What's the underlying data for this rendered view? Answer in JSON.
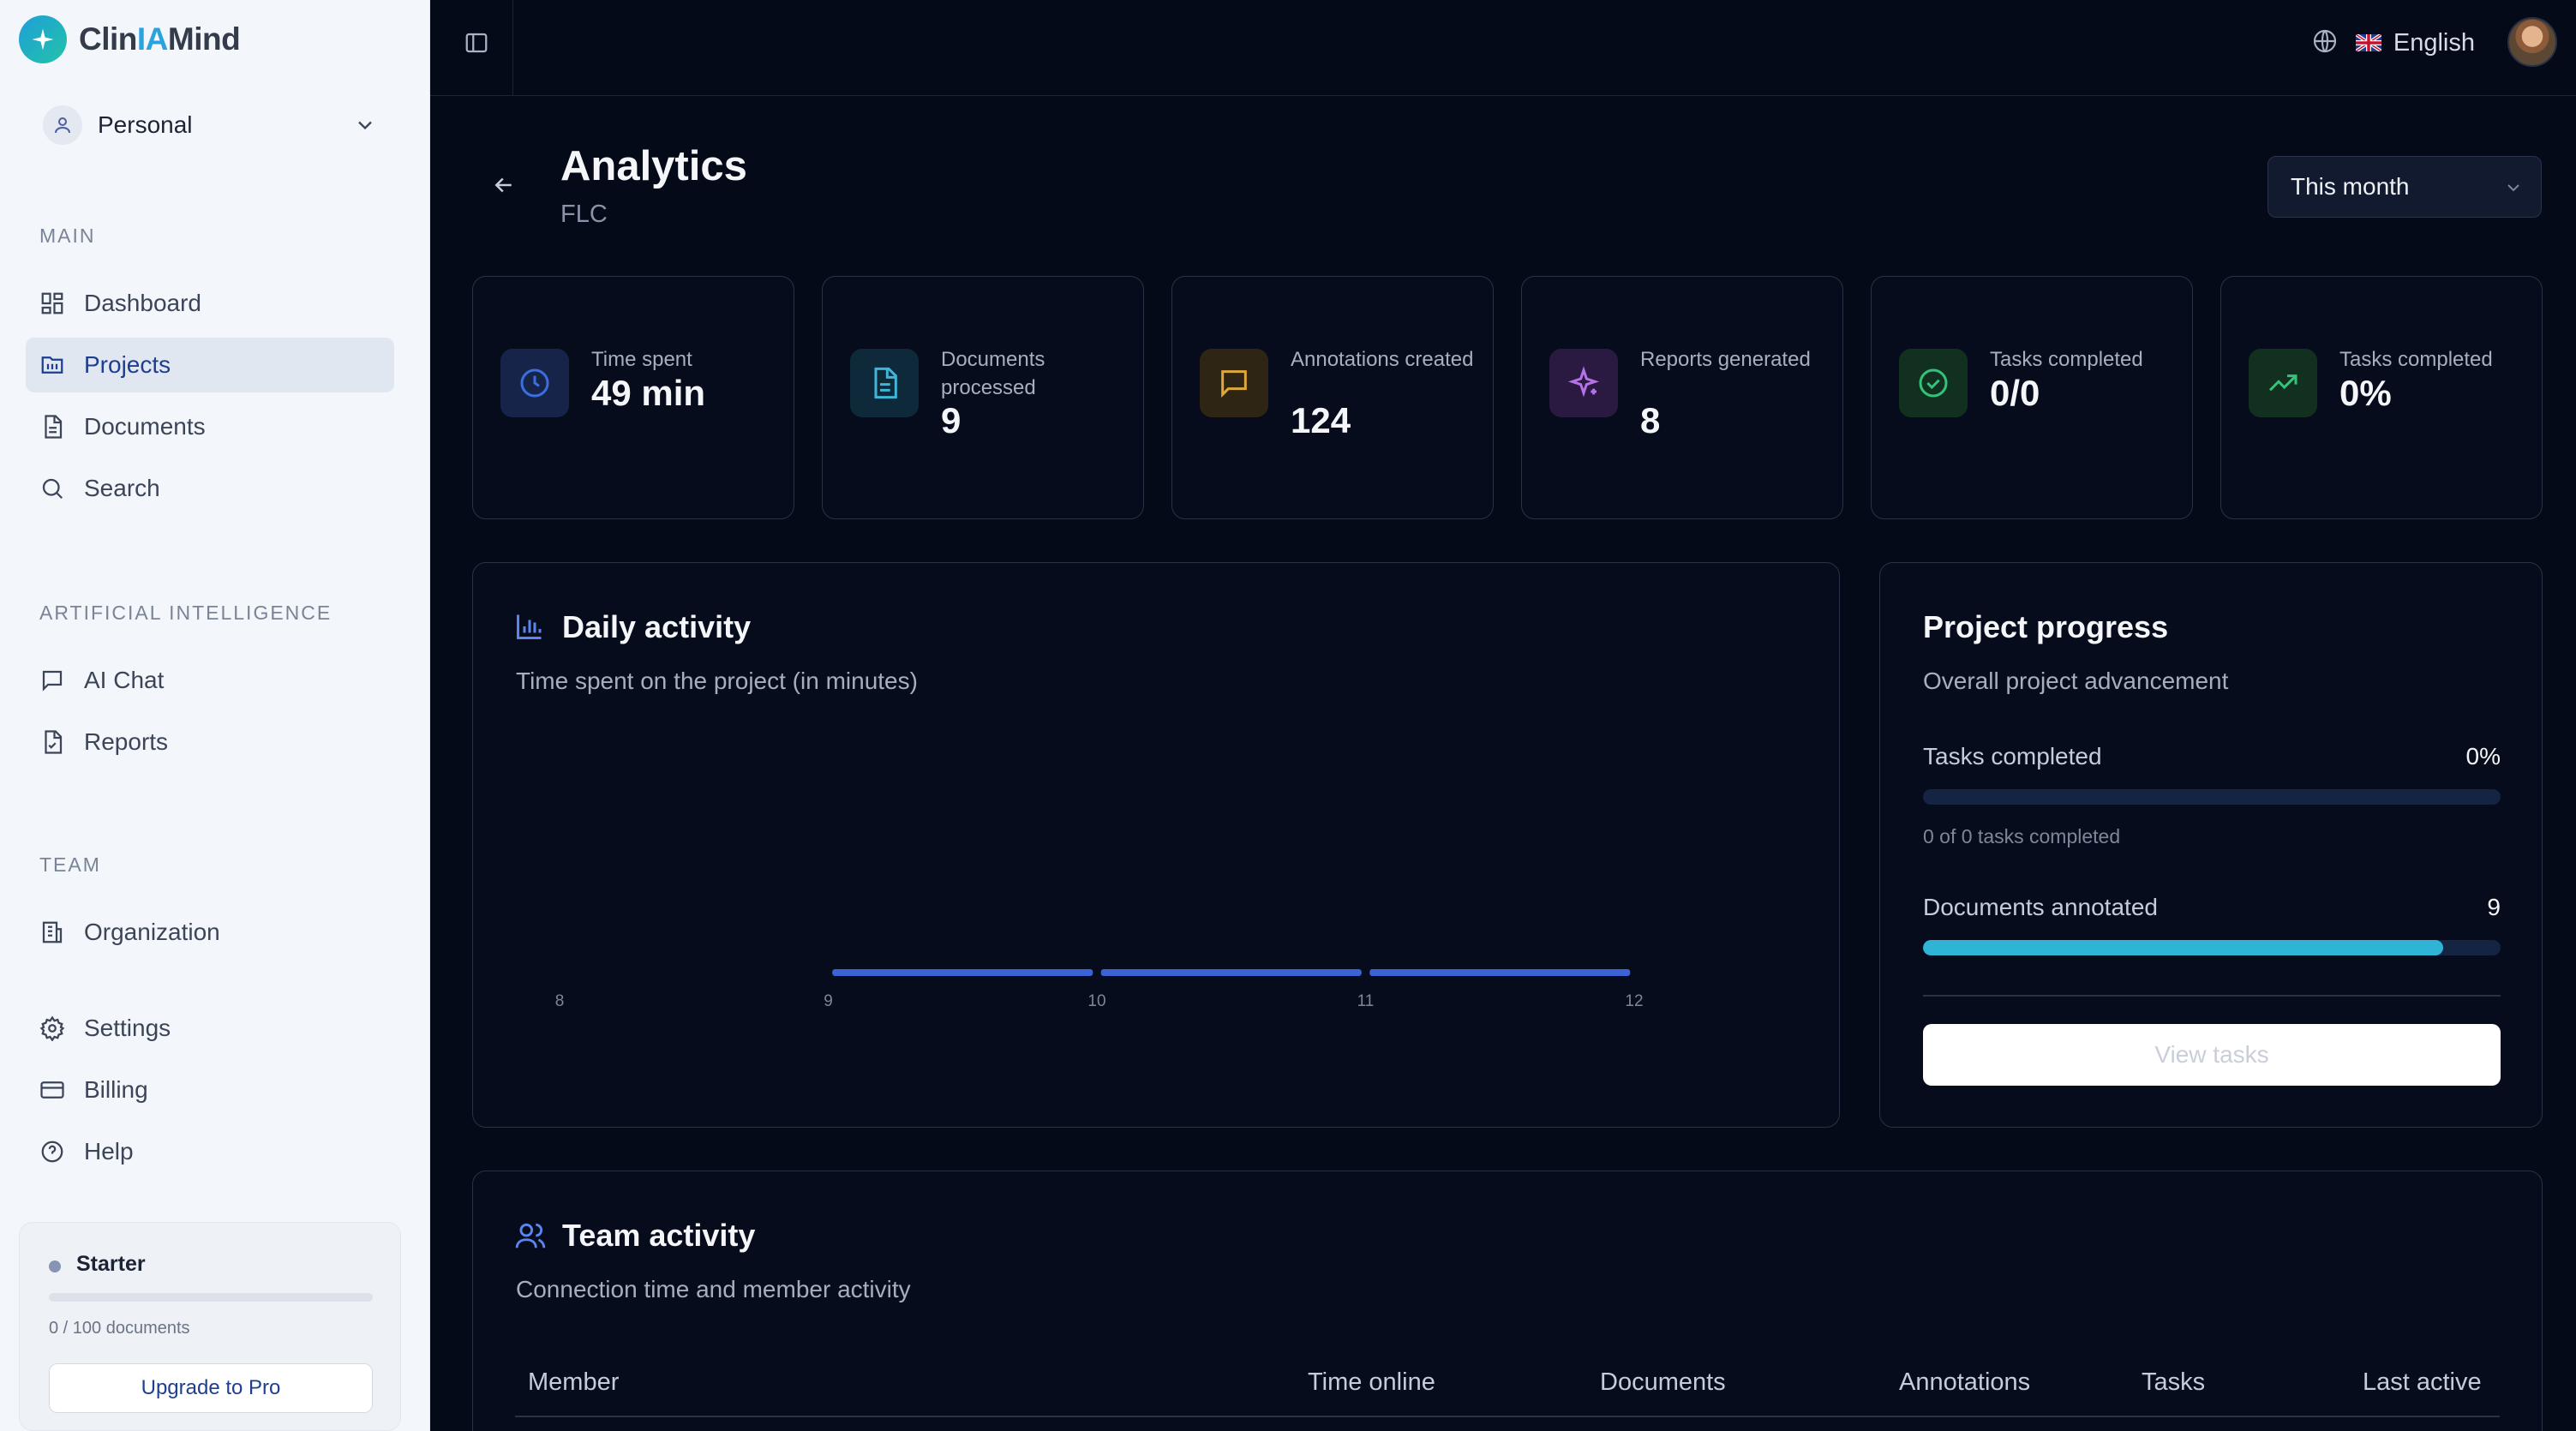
{
  "brand": {
    "name_prefix": "Clin",
    "name_accent": "IA",
    "name_suffix": "Mind"
  },
  "workspace": {
    "label": "Personal"
  },
  "sidebar": {
    "sections": [
      {
        "title": "MAIN",
        "items": [
          {
            "label": "Dashboard",
            "icon": "dashboard-icon",
            "active": false
          },
          {
            "label": "Projects",
            "icon": "projects-icon",
            "active": true
          },
          {
            "label": "Documents",
            "icon": "document-icon",
            "active": false
          },
          {
            "label": "Search",
            "icon": "search-icon",
            "active": false
          }
        ]
      },
      {
        "title": "ARTIFICIAL INTELLIGENCE",
        "items": [
          {
            "label": "AI Chat",
            "icon": "chat-icon",
            "active": false
          },
          {
            "label": "Reports",
            "icon": "report-icon",
            "active": false
          }
        ]
      },
      {
        "title": "TEAM",
        "items": [
          {
            "label": "Organization",
            "icon": "building-icon",
            "active": false
          }
        ]
      }
    ],
    "footer_items": [
      {
        "label": "Settings",
        "icon": "gear-icon"
      },
      {
        "label": "Billing",
        "icon": "credit-card-icon"
      },
      {
        "label": "Help",
        "icon": "help-icon"
      }
    ],
    "plan": {
      "name": "Starter",
      "usage": "0 / 100 documents",
      "upgrade_label": "Upgrade to Pro",
      "used_fraction": 0
    }
  },
  "topbar": {
    "language": "English"
  },
  "page": {
    "title": "Analytics",
    "subtitle": "FLC",
    "period": "This month"
  },
  "stats": [
    {
      "label": "Time spent",
      "value": "49 min",
      "icon": "clock-icon",
      "color": "#3b6fe0",
      "bg": "#16244a"
    },
    {
      "label": "Documents processed",
      "value": "9",
      "icon": "file-text-icon",
      "color": "#3fb6d8",
      "bg": "#0e2a3a"
    },
    {
      "label": "Annotations created",
      "value": "124",
      "icon": "message-square-icon",
      "color": "#e0a73a",
      "bg": "#2f2514"
    },
    {
      "label": "Reports generated",
      "value": "8",
      "icon": "sparkles-icon",
      "color": "#b673e8",
      "bg": "#2a1a42"
    },
    {
      "label": "Tasks completed",
      "value": "0/0",
      "icon": "check-circle-icon",
      "color": "#34c37a",
      "bg": "#11301f"
    },
    {
      "label": "Tasks completed",
      "value": "0%",
      "icon": "trending-up-icon",
      "color": "#34c37a",
      "bg": "#11301f"
    }
  ],
  "daily_activity": {
    "title": "Daily activity",
    "description": "Time spent on the project (in minutes)"
  },
  "chart_data": {
    "type": "bar",
    "title": "Daily activity",
    "categories": [
      "8",
      "9",
      "10",
      "11",
      "12"
    ],
    "values": [
      0,
      1,
      1,
      1,
      0
    ],
    "xlabel": "",
    "ylabel": "",
    "colors": {
      "bar": "#3b63d6"
    }
  },
  "project_progress": {
    "title": "Project progress",
    "description": "Overall project advancement",
    "tasks_label": "Tasks completed",
    "tasks_value": "0%",
    "tasks_fraction": 0,
    "tasks_caption": "0 of 0 tasks completed",
    "docs_label": "Documents annotated",
    "docs_value": "9",
    "docs_fraction": 0.9,
    "button_label": "View tasks"
  },
  "team_activity": {
    "title": "Team activity",
    "description": "Connection time and member activity",
    "columns": [
      "Member",
      "Time online",
      "Documents",
      "Annotations",
      "Tasks",
      "Last active"
    ]
  }
}
